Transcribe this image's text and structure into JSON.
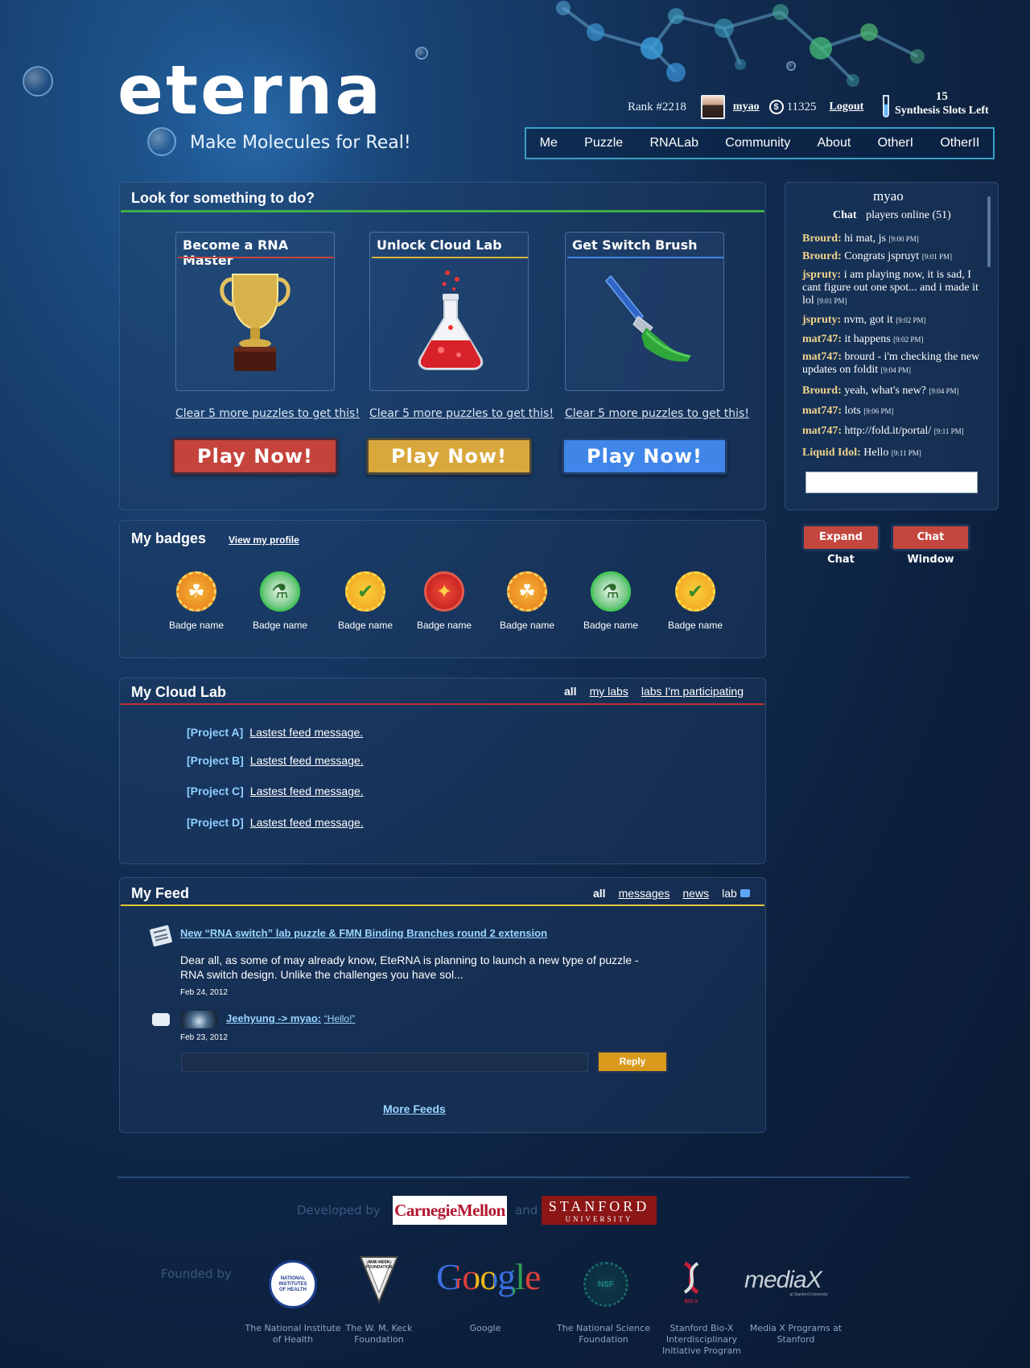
{
  "brand": {
    "logo": "eterna",
    "tagline": "Make Molecules for Real!"
  },
  "user": {
    "rank": "Rank #2218",
    "name": "myao",
    "coins": "11325",
    "logout": "Logout",
    "slots_count": "15",
    "slots_label": "Synthesis Slots Left"
  },
  "nav": [
    "Me",
    "Puzzle",
    "RNALab",
    "Community",
    "About",
    "OtherI",
    "OtherII"
  ],
  "todo": {
    "title": "Look for something to do?",
    "cards": [
      {
        "title": "Become a RNA Master",
        "link": "Clear 5 more puzzles to get this!",
        "button": "Play Now!"
      },
      {
        "title": "Unlock Cloud Lab",
        "link": "Clear 5 more puzzles to get this!",
        "button": "Play Now!"
      },
      {
        "title": "Get Switch Brush",
        "link": "Clear 5 more puzzles to get this!",
        "button": "Play Now!"
      }
    ]
  },
  "badges": {
    "title": "My badges",
    "profile_link": "View my profile",
    "items": [
      "Badge name",
      "Badge name",
      "Badge name",
      "Badge name",
      "Badge name",
      "Badge name",
      "Badge name"
    ]
  },
  "cloudlab": {
    "title": "My Cloud Lab",
    "tabs": [
      "all",
      "my labs",
      "labs I'm participating"
    ],
    "projects": [
      {
        "tag": "[Project A]",
        "msg": "Lastest feed message."
      },
      {
        "tag": "[Project B]",
        "msg": "Lastest feed message."
      },
      {
        "tag": "[Project C]",
        "msg": "Lastest feed message."
      },
      {
        "tag": "[Project D]",
        "msg": "Lastest feed message."
      }
    ]
  },
  "feed": {
    "title": "My Feed",
    "tabs": [
      "all",
      "messages",
      "news",
      "lab"
    ],
    "news_title": "New “RNA switch” lab puzzle & FMN Binding Branches round 2 extension",
    "news_body": "Dear all, as some of may already know, EteRNA is planning to launch a new type of puzzle - RNA switch design. Unlike the challenges you have sol...",
    "news_date": "Feb 24, 2012",
    "msg_from": "Jeehyung -> myao:",
    "msg_text": "“Hello!”",
    "msg_date": "Feb 23, 2012",
    "reply_button": "Reply",
    "more": "More Feeds"
  },
  "chat": {
    "user": "myao",
    "label": "Chat",
    "online": "players online (51)",
    "messages": [
      {
        "who": "Brourd:",
        "text": "hi mat, js",
        "time": "[9:00 PM]"
      },
      {
        "who": "Brourd:",
        "text": "Congrats jspruyt",
        "time": "[9:01 PM]"
      },
      {
        "who": "jspruty:",
        "text": "i am playing now, it is sad, I cant figure out one spot... and i made it lol",
        "time": "[9:01 PM]"
      },
      {
        "who": "jspruty:",
        "text": "nvm, got it",
        "time": "[9:02 PM]"
      },
      {
        "who": "mat747:",
        "text": "it happens",
        "time": "[9:02 PM]"
      },
      {
        "who": "mat747:",
        "text": "brourd - i'm checking the new updates on foldit",
        "time": "[9:04 PM]"
      },
      {
        "who": "Brourd:",
        "text": "yeah, what's new?",
        "time": "[9:04 PM]"
      },
      {
        "who": "mat747:",
        "text": "lots",
        "time": "[9:06 PM]"
      },
      {
        "who": "mat747:",
        "text": "http://fold.it/portal/",
        "time": "[9:11 PM]"
      },
      {
        "who": "Liquid Idol:",
        "text": "Hello",
        "time": "[9:11 PM]"
      }
    ],
    "expand": "Expand Chat",
    "window": "Chat Window"
  },
  "footer": {
    "developed_by": "Developed by",
    "and": "and",
    "cmu": "CarnegieMellon",
    "stanford_top": "STANFORD",
    "stanford_bottom": "UNIVERSITY",
    "founded_by": "Founded by",
    "sponsors": [
      "The National Institute of Health",
      "The W. M. Keck Foundation",
      "Google",
      "The National Science Foundation",
      "Stanford Bio-X Interdisciplinary Initiative Program",
      "Media X Programs at Stanford"
    ],
    "logo_texts": {
      "nih": "NATIONAL INSTITUTES OF HEALTH",
      "keck": "W.M. KECK FOUNDATION",
      "google": "Google",
      "nsf": "NSF",
      "biox": "BIO-X",
      "mediax": "mediaX",
      "mediax_sub": "at Stanford University"
    },
    "colors": {
      "cmu_red": "#b3162f",
      "stanford_red": "#8c1515"
    }
  },
  "colors": {
    "red": "#c4443c",
    "yellow": "#d9a83c",
    "blue": "#3f86e8",
    "green_line": "#3fae49"
  }
}
